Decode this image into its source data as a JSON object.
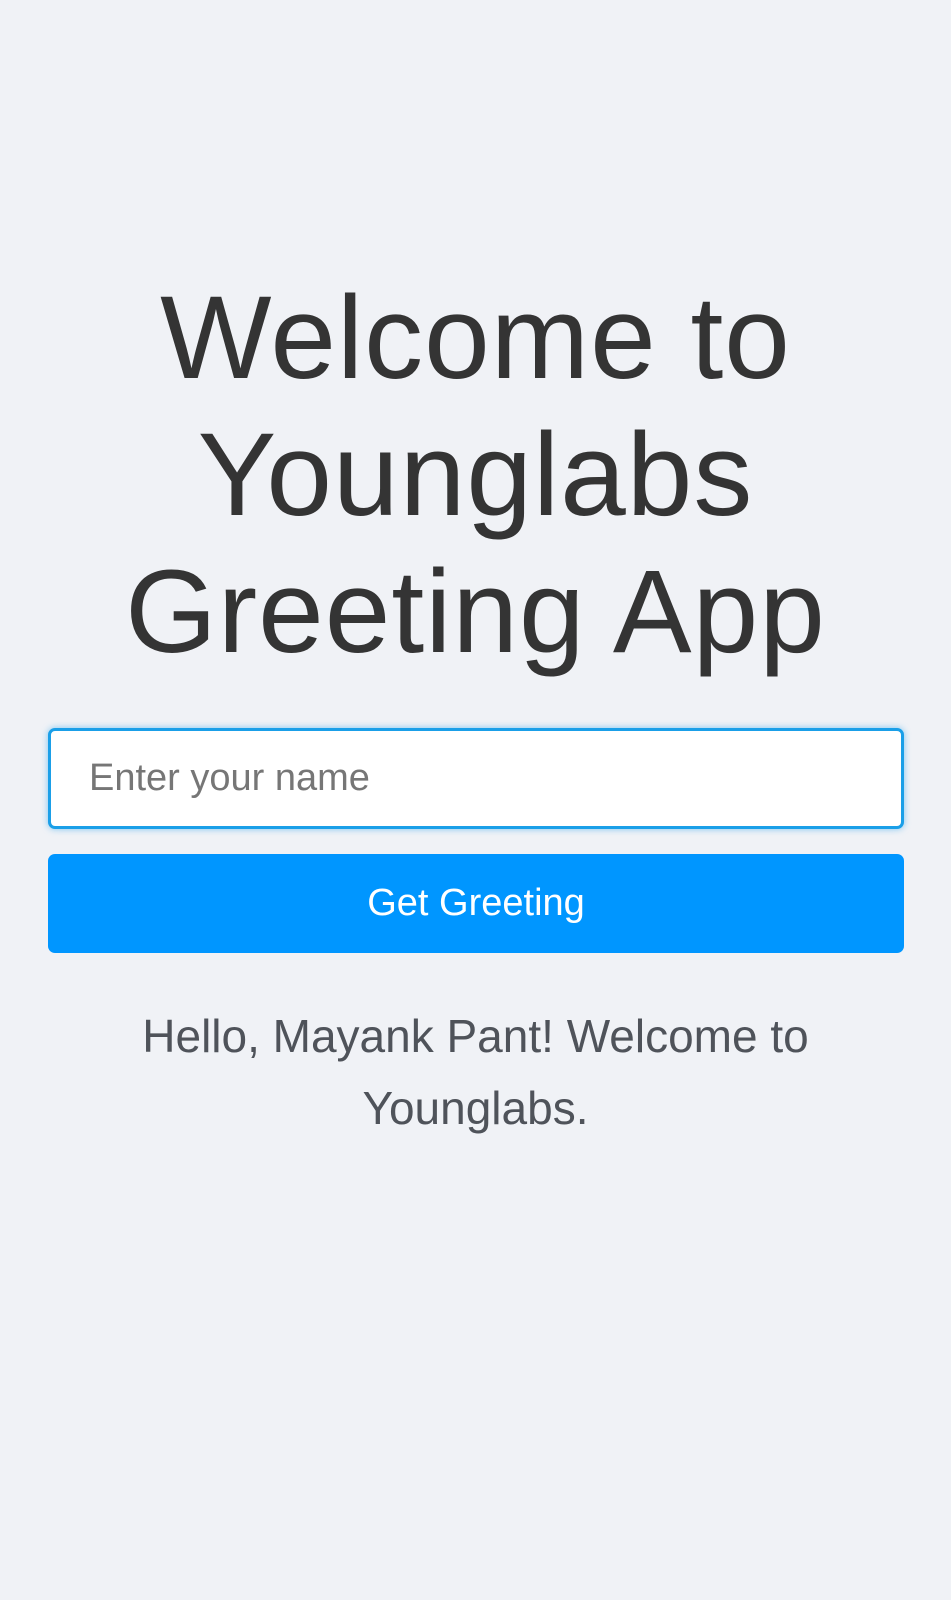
{
  "app": {
    "title": "Welcome to Younglabs Greeting App"
  },
  "form": {
    "name_input": {
      "value": "",
      "placeholder": "Enter your name"
    },
    "submit_label": "Get Greeting"
  },
  "result": {
    "message": "Hello, Mayank Pant! Welcome to Younglabs."
  },
  "colors": {
    "background": "#f0f2f6",
    "accent": "#0096ff",
    "input_focus_border": "#1a9fe8",
    "title_text": "#343434",
    "message_text": "#4f535a"
  }
}
